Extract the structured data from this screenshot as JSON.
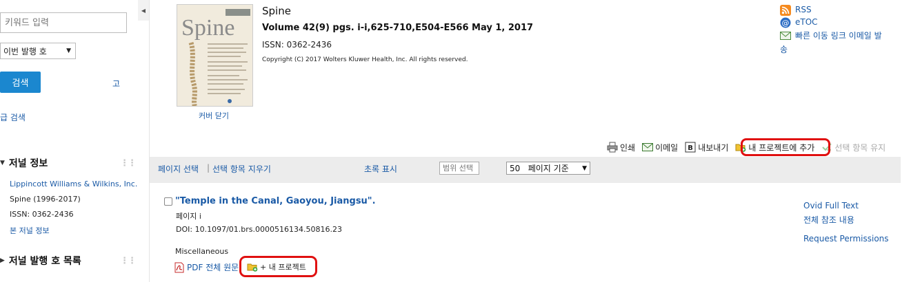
{
  "sidebar": {
    "search_placeholder": "키워드 입력",
    "issue_select": "이번 발행 호",
    "search_button": "검색",
    "reset_link": "고",
    "advanced_link": "급 검색",
    "journal_info_heading": "저널 정보",
    "publisher": "Lippincott Williams & Wilkins, Inc.",
    "journal_years": "Spine (1996-2017)",
    "issn": "ISSN: 0362-2436",
    "journal_info_link": "본 저널 정보",
    "issues_heading": "저널 발행 호 목록"
  },
  "journal": {
    "title": "Spine",
    "volume": "Volume 42(9) pgs. i-i,625-710,E504-E566 May 1, 2017",
    "issn": "ISSN: 0362-2436",
    "copyright": "Copyright (C) 2017 Wolters Kluwer Health, Inc. All rights reserved.",
    "cover_title": "Spine",
    "cover_close": "커버 닫기"
  },
  "right_links": {
    "rss": "RSS",
    "etoc": "eTOC",
    "quick_link_line1": "빠른 이동 링크 이메일 발",
    "quick_link_line2": "송"
  },
  "toolbar": {
    "print": "인쇄",
    "email": "이메일",
    "export": "내보내기",
    "add_project": "내 프로젝트에 추가",
    "keep_selected": "선택 항목 유지"
  },
  "results_bar": {
    "select_page": "페이지 선택",
    "clear_selected": "선택 항목 지우기",
    "range_placeholder": "범위 선택",
    "show_abstract": "초록 표시",
    "per_page": "50   페이지 기준"
  },
  "article": {
    "title": "\"Temple in the Canal, Gaoyou, Jiangsu\".",
    "page": "페이지 i",
    "doi": "DOI: 10.1097/01.brs.0000516134.50816.23",
    "category": "Miscellaneous",
    "pdf_link": "PDF 전체 원문",
    "add_project": "+ 내 프로젝트",
    "ovid_full_text": "Ovid Full Text",
    "full_reference": "전체 참조 내용",
    "request_permissions": "Request Permissions"
  },
  "colors": {
    "link": "#1a5aa6",
    "search_button": "#1b87cf",
    "highlight": "#e01010",
    "results_bar_bg": "#ececec"
  }
}
